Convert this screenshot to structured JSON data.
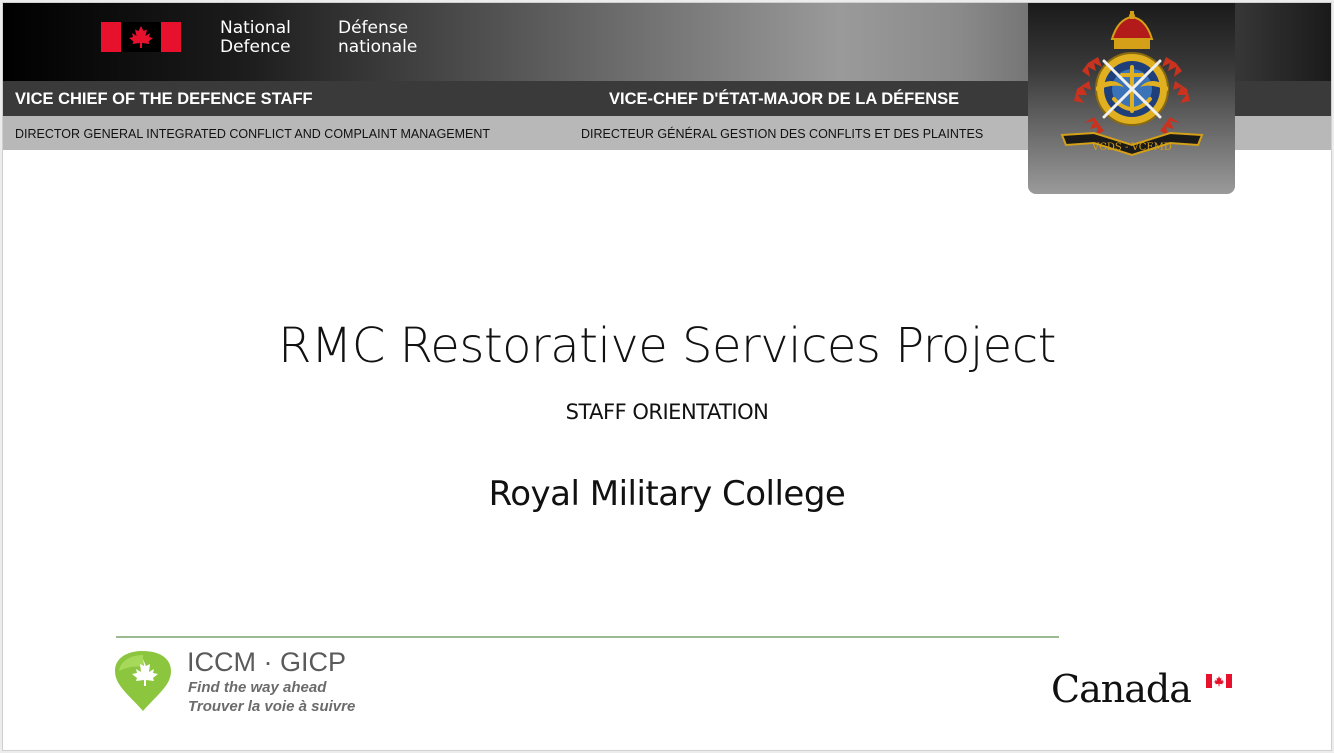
{
  "header": {
    "department_en": [
      "National",
      "Defence"
    ],
    "department_fr": [
      "Défense",
      "nationale"
    ],
    "org_en": "VICE CHIEF OF THE DEFENCE STAFF",
    "org_fr": "VICE-CHEF D'ÉTAT-MAJOR DE LA DÉFENSE",
    "division_en": "DIRECTOR GENERAL INTEGRATED CONFLICT AND COMPLAINT MANAGEMENT",
    "division_fr": "DIRECTEUR GÉNÉRAL GESTION DES CONFLITS ET DES PLAINTES",
    "crest_icon": "vcds-crest-icon",
    "crest_motto": "VCDS - VCEMD",
    "flag_icon": "canada-flag-icon"
  },
  "slide": {
    "title": "RMC Restorative Services Project",
    "subtitle": "STAFF ORIENTATION",
    "institution": "Royal Military College"
  },
  "footer": {
    "iccm_title": "ICCM · GICP",
    "tagline_en": "Find the way ahead",
    "tagline_fr": "Trouver la voie à suivre",
    "iccm_icon": "maple-leaf-pin-icon",
    "wordmark": "Canad",
    "wordmark_last": "a"
  },
  "colors": {
    "flag_red": "#e8112d",
    "divider_green": "#9cba92",
    "iccm_green": "#8cc63f",
    "banner_dark": "#3a3a3a",
    "banner_light": "#b8b8b8"
  }
}
